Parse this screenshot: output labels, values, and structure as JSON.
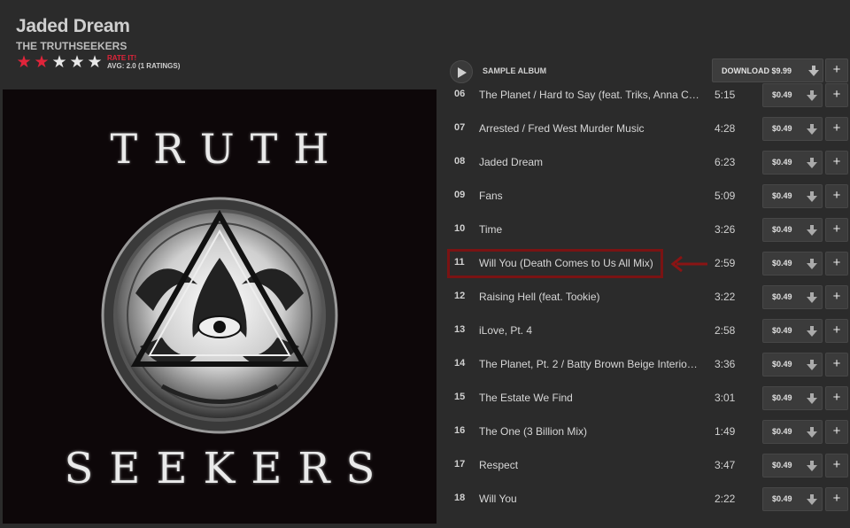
{
  "album": {
    "title": "Jaded Dream",
    "artist": "THE TRUTHSEEKERS",
    "rating": {
      "value": 2,
      "max": 5,
      "rate_label": "RATE IT!",
      "avg_label": "AVG: 2.0 (1 RATINGS)"
    },
    "cover": {
      "word_top": "TRUTH",
      "word_bottom": "SEEKERS"
    }
  },
  "player": {
    "sample_label": "SAMPLE ALBUM",
    "download_label": "DOWNLOAD $9.99",
    "add_label": "+"
  },
  "tracks": [
    {
      "num": "06",
      "title": "The Planet / Hard to Say (feat. Triks, Anna C…",
      "duration": "5:15",
      "price": "$0.49"
    },
    {
      "num": "07",
      "title": "Arrested / Fred West Murder Music",
      "duration": "4:28",
      "price": "$0.49"
    },
    {
      "num": "08",
      "title": "Jaded Dream",
      "duration": "6:23",
      "price": "$0.49"
    },
    {
      "num": "09",
      "title": "Fans",
      "duration": "5:09",
      "price": "$0.49"
    },
    {
      "num": "10",
      "title": "Time",
      "duration": "3:26",
      "price": "$0.49"
    },
    {
      "num": "11",
      "title": "Will You (Death Comes to Us All Mix)",
      "duration": "2:59",
      "price": "$0.49"
    },
    {
      "num": "12",
      "title": "Raising Hell (feat. Tookie)",
      "duration": "3:22",
      "price": "$0.49"
    },
    {
      "num": "13",
      "title": "iLove, Pt. 4",
      "duration": "2:58",
      "price": "$0.49"
    },
    {
      "num": "14",
      "title": "The Planet, Pt. 2 / Batty Brown Beige Interio…",
      "duration": "3:36",
      "price": "$0.49"
    },
    {
      "num": "15",
      "title": "The Estate We Find",
      "duration": "3:01",
      "price": "$0.49"
    },
    {
      "num": "16",
      "title": "The One (3 Billion Mix)",
      "duration": "1:49",
      "price": "$0.49"
    },
    {
      "num": "17",
      "title": "Respect",
      "duration": "3:47",
      "price": "$0.49"
    },
    {
      "num": "18",
      "title": "Will You",
      "duration": "2:22",
      "price": "$0.49"
    }
  ],
  "highlight": {
    "track_num": "11",
    "color": "#7a1313"
  },
  "colors": {
    "star_on": "#e0243a",
    "star_off": "#e8e8e8",
    "background": "#2b2b2b"
  }
}
